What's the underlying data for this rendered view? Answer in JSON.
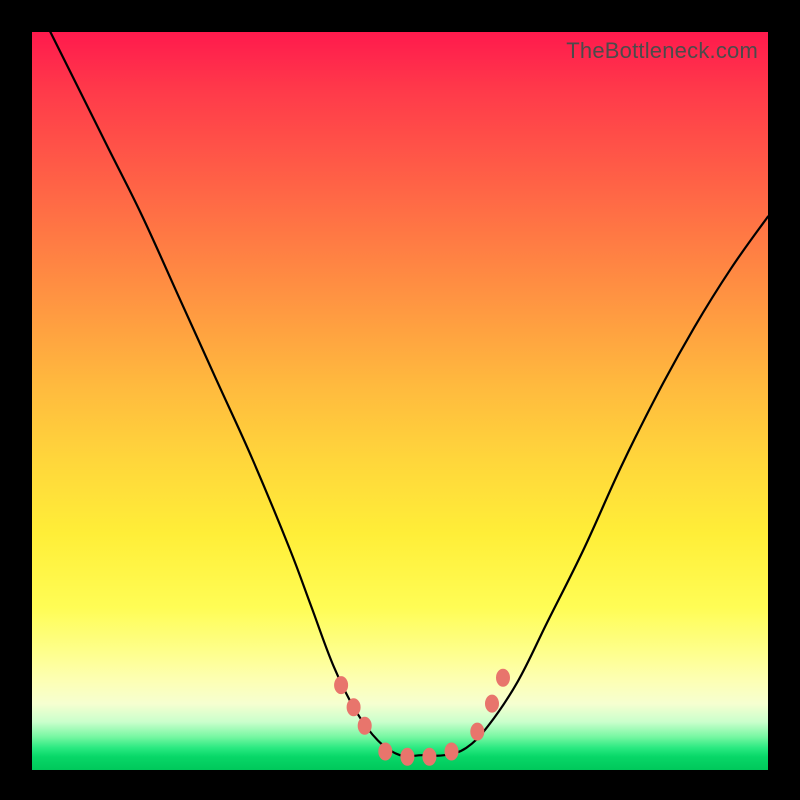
{
  "attribution": "TheBottleneck.com",
  "colors": {
    "frame": "#000000",
    "curve": "#000000",
    "marker": "#e8756c"
  },
  "chart_data": {
    "type": "line",
    "title": "",
    "xlabel": "",
    "ylabel": "",
    "xlim": [
      0,
      100
    ],
    "ylim": [
      0,
      100
    ],
    "grid": false,
    "legend": false,
    "background": "rainbow-gradient-red-to-green",
    "series": [
      {
        "name": "bottleneck-curve",
        "note": "V-shaped curve; values approximated from pixel positions (y = 0 at bottom, 100 at top)",
        "x": [
          2,
          5,
          10,
          15,
          20,
          25,
          30,
          35,
          38,
          41,
          44,
          47,
          50,
          53,
          56,
          59,
          62,
          66,
          70,
          75,
          80,
          85,
          90,
          95,
          100
        ],
        "y": [
          101,
          95,
          85,
          75,
          64,
          53,
          42,
          30,
          22,
          14,
          8,
          4,
          2,
          2,
          2,
          3,
          6,
          12,
          20,
          30,
          41,
          51,
          60,
          68,
          75
        ]
      }
    ],
    "markers": {
      "note": "Small salmon markers near the valley bottom, approximated positions (x in 0-100, y in 0-100)",
      "points": [
        {
          "x": 42.0,
          "y": 11.5
        },
        {
          "x": 43.7,
          "y": 8.5
        },
        {
          "x": 45.2,
          "y": 6.0
        },
        {
          "x": 48.0,
          "y": 2.5
        },
        {
          "x": 51.0,
          "y": 1.8
        },
        {
          "x": 54.0,
          "y": 1.8
        },
        {
          "x": 57.0,
          "y": 2.5
        },
        {
          "x": 60.5,
          "y": 5.2
        },
        {
          "x": 62.5,
          "y": 9.0
        },
        {
          "x": 64.0,
          "y": 12.5
        }
      ]
    }
  }
}
